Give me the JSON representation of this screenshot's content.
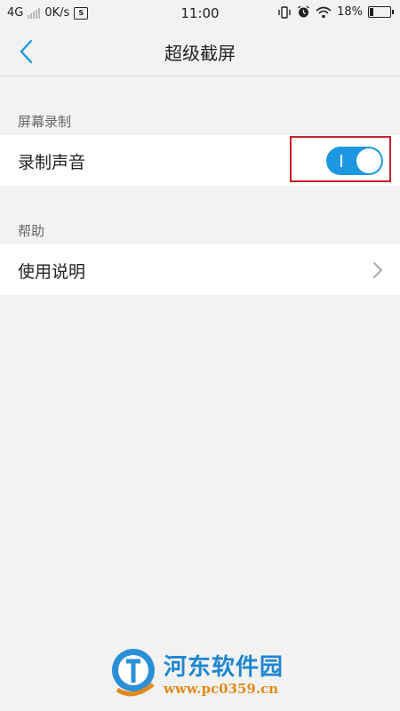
{
  "status_bar": {
    "network": "4G",
    "speed": "0K/s",
    "time": "11:00",
    "battery": "18%",
    "battery_level": 0.18
  },
  "nav": {
    "title": "超级截屏"
  },
  "sections": [
    {
      "header": "屏幕录制",
      "row_label": "录制声音",
      "toggle_on": true
    },
    {
      "header": "帮助",
      "row_label": "使用说明"
    }
  ],
  "watermark": {
    "title": "河东软件园",
    "url": "www.pc0359.cn"
  },
  "colors": {
    "accent": "#1b98e0",
    "highlight": "#c8202a",
    "background": "#f2f2f2"
  },
  "icons": [
    "signal-icon",
    "sim-icon",
    "vibrate-icon",
    "alarm-icon",
    "wifi-icon",
    "battery-icon",
    "back-chevron-icon",
    "chevron-right-icon"
  ]
}
